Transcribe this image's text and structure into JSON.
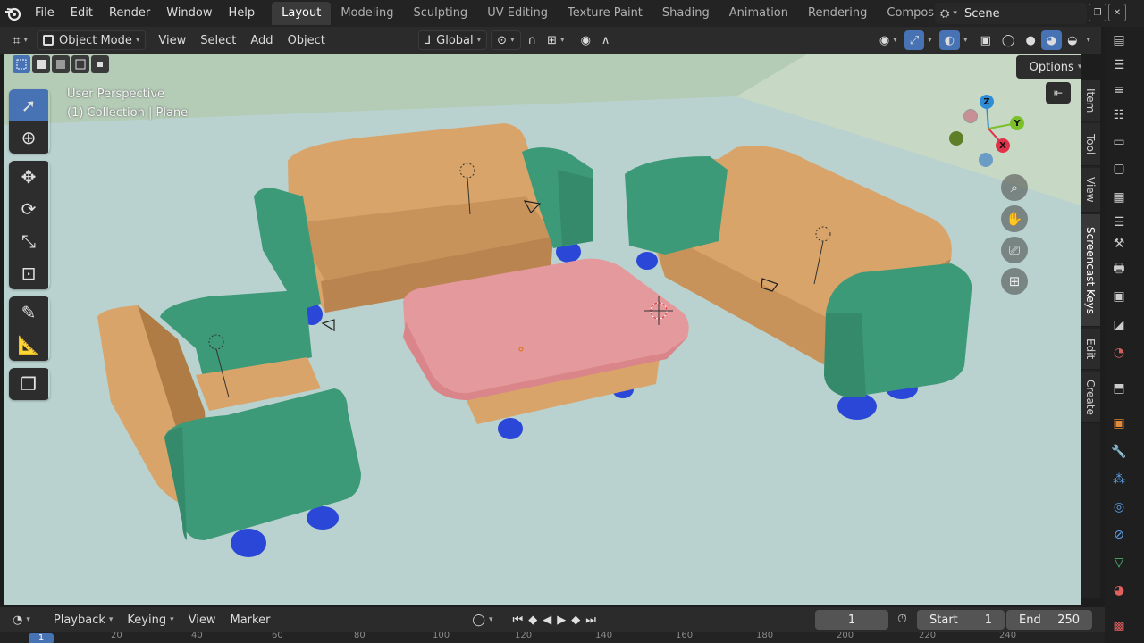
{
  "menu": [
    "File",
    "Edit",
    "Render",
    "Window",
    "Help"
  ],
  "workspaces": [
    "Layout",
    "Modeling",
    "Sculpting",
    "UV Editing",
    "Texture Paint",
    "Shading",
    "Animation",
    "Rendering",
    "Compositin"
  ],
  "active_workspace": "Layout",
  "scene": {
    "name": "Scene"
  },
  "viewport_header": {
    "mode": "Object Mode",
    "menus": [
      "View",
      "Select",
      "Add",
      "Object"
    ],
    "orientation": "Global"
  },
  "overlay": {
    "perspective": "User Perspective",
    "collection": "(1) Collection | Plane"
  },
  "options_label": "Options",
  "gizmo": {
    "x": "X",
    "y": "Y",
    "z": "Z"
  },
  "side_tabs": [
    "Item",
    "Tool",
    "View",
    "Screencast Keys",
    "Edit",
    "Create"
  ],
  "active_side_tab": "Screencast Keys",
  "tools": [
    "select-box",
    "cursor",
    "move",
    "rotate",
    "scale",
    "transform",
    "annotate",
    "measure",
    "add-cube"
  ],
  "timeline": {
    "menus": [
      "Playback",
      "Keying",
      "View",
      "Marker"
    ],
    "current_frame": "1",
    "start_label": "Start",
    "start": "1",
    "end_label": "End",
    "end": "250"
  },
  "ruler_ticks": [
    "1",
    "20",
    "40",
    "60",
    "80",
    "100",
    "120",
    "140",
    "160",
    "180",
    "200",
    "220",
    "240"
  ],
  "colors": {
    "accent": "#4772b3",
    "sofa": "#d9a46a",
    "arm": "#3d9a78",
    "leg": "#2a47d8",
    "table": "#e49a9c",
    "floor": "#b9d2cf"
  }
}
